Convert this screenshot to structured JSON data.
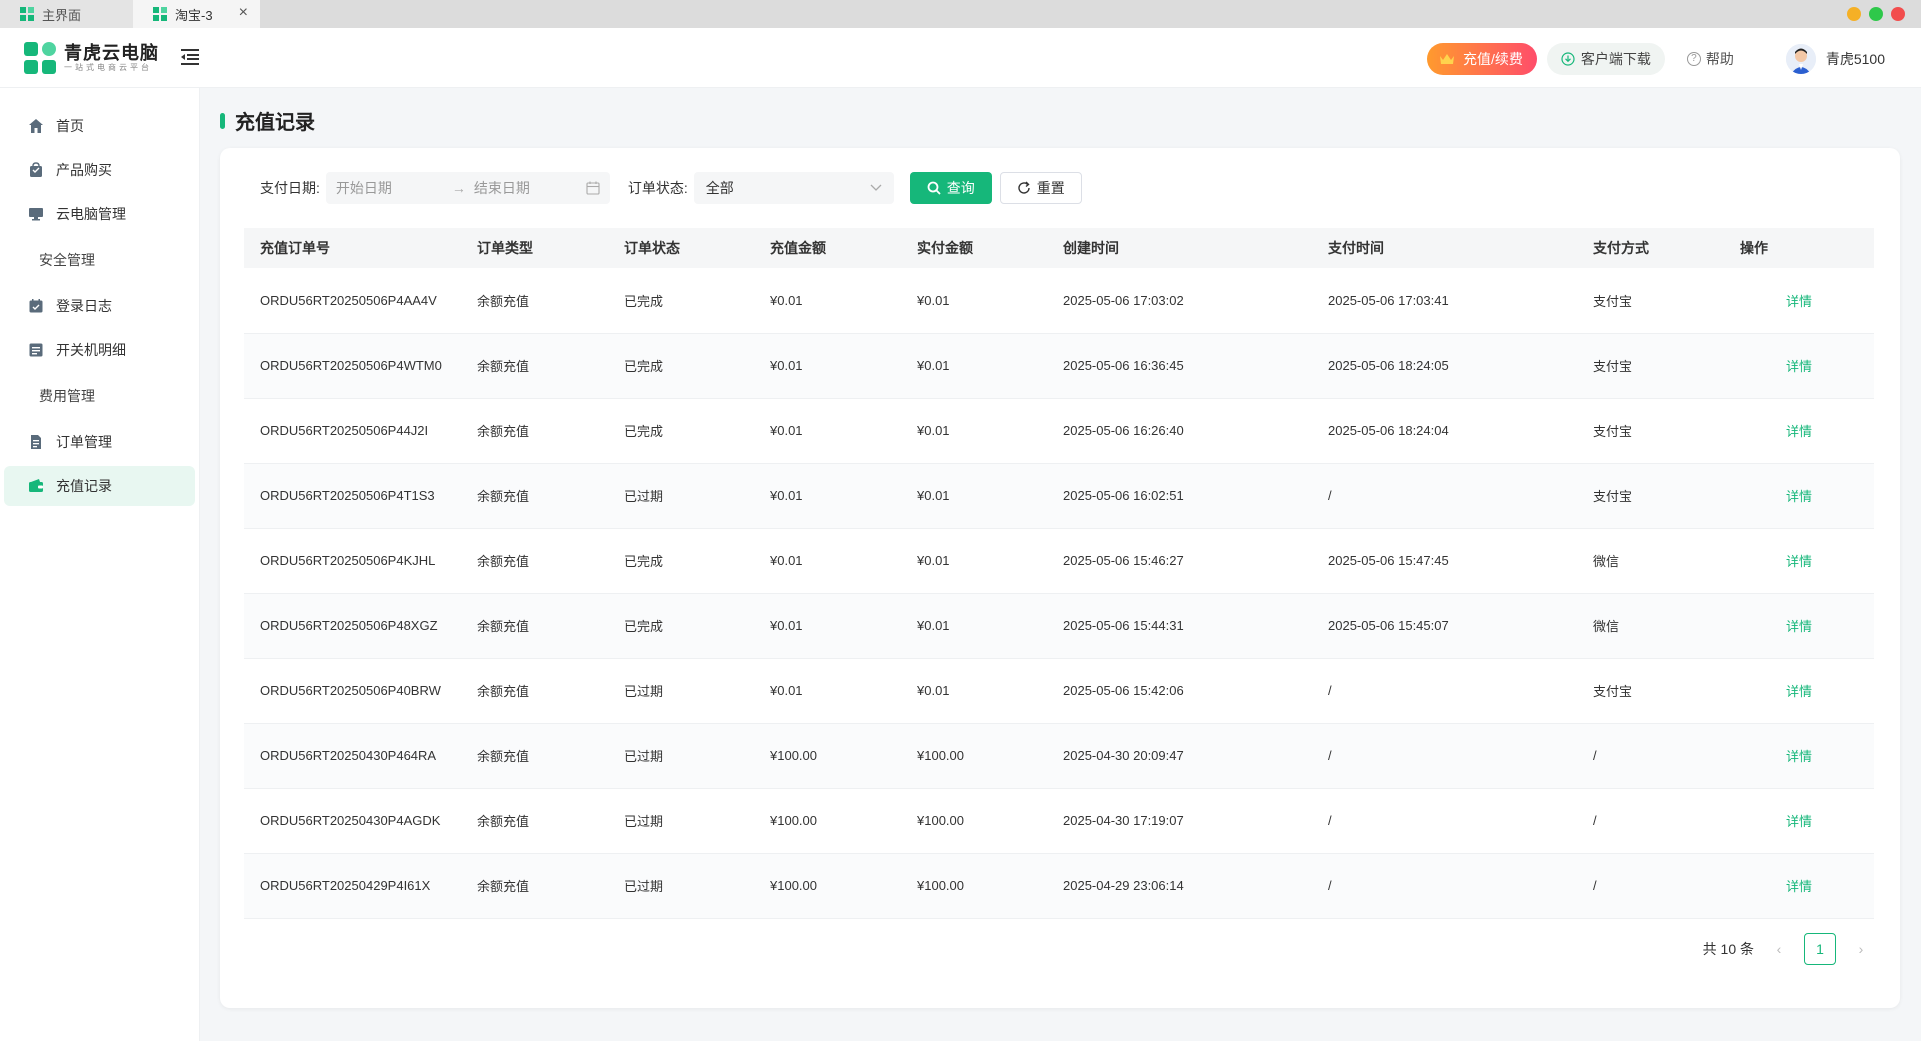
{
  "tabs": [
    {
      "label": "主界面"
    },
    {
      "label": "淘宝-3"
    }
  ],
  "window_controls": {
    "colors": [
      "#f5b026",
      "#2ec84a",
      "#f24d4d"
    ]
  },
  "header": {
    "logo_title": "青虎云电脑",
    "logo_subtitle": "一站式电商云平台",
    "recharge_label": "充值/续费",
    "download_label": "客户端下载",
    "help_label": "帮助",
    "username": "青虎5100"
  },
  "sidebar": {
    "items": [
      {
        "label": "首页",
        "icon": "home-icon"
      },
      {
        "label": "产品购买",
        "icon": "cart-icon"
      },
      {
        "label": "云电脑管理",
        "icon": "monitor-icon"
      },
      {
        "label": "安全管理",
        "icon": ""
      },
      {
        "label": "登录日志",
        "icon": "calendar-icon"
      },
      {
        "label": "开关机明细",
        "icon": "list-icon"
      },
      {
        "label": "费用管理",
        "icon": ""
      },
      {
        "label": "订单管理",
        "icon": "document-icon"
      },
      {
        "label": "充值记录",
        "icon": "wallet-icon"
      }
    ],
    "active": "充值记录"
  },
  "page": {
    "title": "充值记录"
  },
  "filters": {
    "pay_date_label": "支付日期:",
    "start_placeholder": "开始日期",
    "end_placeholder": "结束日期",
    "status_label": "订单状态:",
    "status_value": "全部",
    "query_label": "查询",
    "reset_label": "重置"
  },
  "table": {
    "columns": [
      "充值订单号",
      "订单类型",
      "订单状态",
      "充值金额",
      "实付金额",
      "创建时间",
      "支付时间",
      "支付方式",
      "操作"
    ],
    "detail_label": "详情",
    "rows": [
      [
        "ORDU56RT20250506P4AA4V",
        "余额充值",
        "已完成",
        "¥0.01",
        "¥0.01",
        "2025-05-06 17:03:02",
        "2025-05-06 17:03:41",
        "支付宝"
      ],
      [
        "ORDU56RT20250506P4WTM0",
        "余额充值",
        "已完成",
        "¥0.01",
        "¥0.01",
        "2025-05-06 16:36:45",
        "2025-05-06 18:24:05",
        "支付宝"
      ],
      [
        "ORDU56RT20250506P44J2I",
        "余额充值",
        "已完成",
        "¥0.01",
        "¥0.01",
        "2025-05-06 16:26:40",
        "2025-05-06 18:24:04",
        "支付宝"
      ],
      [
        "ORDU56RT20250506P4T1S3",
        "余额充值",
        "已过期",
        "¥0.01",
        "¥0.01",
        "2025-05-06 16:02:51",
        "/",
        "支付宝"
      ],
      [
        "ORDU56RT20250506P4KJHL",
        "余额充值",
        "已完成",
        "¥0.01",
        "¥0.01",
        "2025-05-06 15:46:27",
        "2025-05-06 15:47:45",
        "微信"
      ],
      [
        "ORDU56RT20250506P48XGZ",
        "余额充值",
        "已完成",
        "¥0.01",
        "¥0.01",
        "2025-05-06 15:44:31",
        "2025-05-06 15:45:07",
        "微信"
      ],
      [
        "ORDU56RT20250506P40BRW",
        "余额充值",
        "已过期",
        "¥0.01",
        "¥0.01",
        "2025-05-06 15:42:06",
        "/",
        "支付宝"
      ],
      [
        "ORDU56RT20250430P464RA",
        "余额充值",
        "已过期",
        "¥100.00",
        "¥100.00",
        "2025-04-30 20:09:47",
        "/",
        "/"
      ],
      [
        "ORDU56RT20250430P4AGDK",
        "余额充值",
        "已过期",
        "¥100.00",
        "¥100.00",
        "2025-04-30 17:19:07",
        "/",
        "/"
      ],
      [
        "ORDU56RT20250429P4I61X",
        "余额充值",
        "已过期",
        "¥100.00",
        "¥100.00",
        "2025-04-29 23:06:14",
        "/",
        "/"
      ]
    ]
  },
  "pagination": {
    "total_label": "共 10 条",
    "current_page": "1",
    "prev": "‹",
    "next": "›"
  },
  "colors": {
    "accent": "#16b77a",
    "recharge_gradient_start": "#ff9a2e",
    "recharge_gradient_end": "#ff4d6a"
  }
}
